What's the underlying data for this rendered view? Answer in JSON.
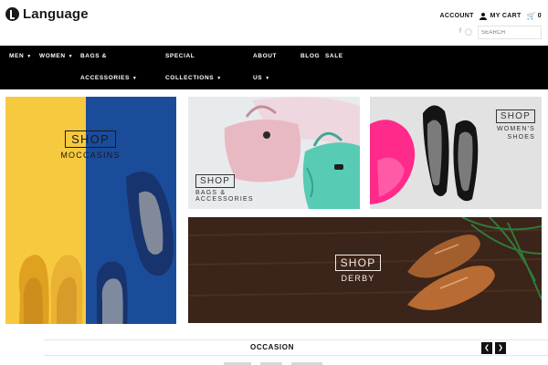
{
  "brand": {
    "name": "Language"
  },
  "utility": {
    "account": "ACCOUNT",
    "cart": "MY CART",
    "cart_count": "0"
  },
  "search": {
    "placeholder": "SEARCH"
  },
  "nav": {
    "men": "MEN",
    "women": "WOMEN",
    "bags_line1": "BAGS &",
    "bags_line2": "ACCESSORIES",
    "special": "SPECIAL",
    "collections": "COLLECTIONS",
    "about_line1": "ABOUT",
    "about_line2": "US",
    "blog": "BLOG",
    "sale": "SALE"
  },
  "tiles": {
    "moccasins": {
      "shop": "SHOP",
      "label": "MOCCASINS"
    },
    "bags": {
      "shop": "SHOP",
      "line1": "BAGS &",
      "line2": "ACCESSORIES"
    },
    "womens": {
      "shop": "SHOP",
      "line1": "WOMEN'S",
      "line2": "SHOES"
    },
    "derby": {
      "shop": "SHOP",
      "label": "DERBY"
    }
  },
  "occasion": {
    "title": "OCCASION"
  },
  "icons": {
    "logo": "language-logo-icon",
    "user": "user-icon",
    "cart": "cart-icon",
    "facebook": "facebook-icon",
    "instagram": "instagram-icon",
    "chevron": "chevron-down-icon",
    "prev": "chevron-left-icon",
    "next": "chevron-right-icon"
  },
  "colors": {
    "nav_bg": "#000000",
    "moccasin_yellow": "#f7c93f",
    "moccasin_blue": "#1a4c9a",
    "derby_wood": "#3b2419",
    "accent_pink": "#ff2a8a"
  }
}
